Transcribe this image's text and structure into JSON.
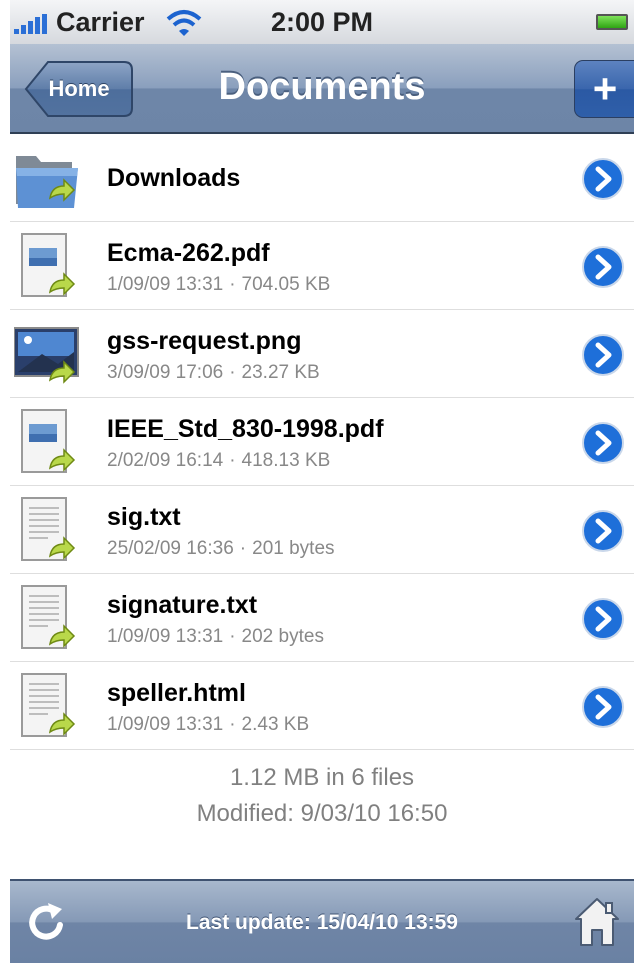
{
  "status_bar": {
    "carrier": "Carrier",
    "time": "2:00 PM"
  },
  "nav": {
    "back_label": "Home",
    "title": "Documents",
    "add_label": "+"
  },
  "files": [
    {
      "name": "Downloads",
      "date": "",
      "size": "",
      "icon": "folder-icon"
    },
    {
      "name": "Ecma-262.pdf",
      "date": "1/09/09 13:31",
      "size": "704.05 KB",
      "icon": "pdf-document-icon"
    },
    {
      "name": "gss-request.png",
      "date": "3/09/09 17:06",
      "size": "23.27 KB",
      "icon": "image-file-icon"
    },
    {
      "name": "IEEE_Std_830-1998.pdf",
      "date": "2/02/09 16:14",
      "size": "418.13 KB",
      "icon": "pdf-document-icon"
    },
    {
      "name": "sig.txt",
      "date": "25/02/09 16:36",
      "size": "201 bytes",
      "icon": "text-document-icon"
    },
    {
      "name": "signature.txt",
      "date": "1/09/09 13:31",
      "size": "202 bytes",
      "icon": "text-document-icon"
    },
    {
      "name": "speller.html",
      "date": "1/09/09 13:31",
      "size": "2.43 KB",
      "icon": "text-document-icon"
    }
  ],
  "summary": {
    "total": "1.12 MB in 6 files",
    "modified": "Modified: 9/03/10 16:50"
  },
  "toolbar": {
    "last_update": "Last update: 15/04/10 13:59"
  },
  "colors": {
    "nav_bar": "#8a9fbd",
    "add_button": "#3a66ad",
    "disclosure": "#1e6fd9"
  }
}
